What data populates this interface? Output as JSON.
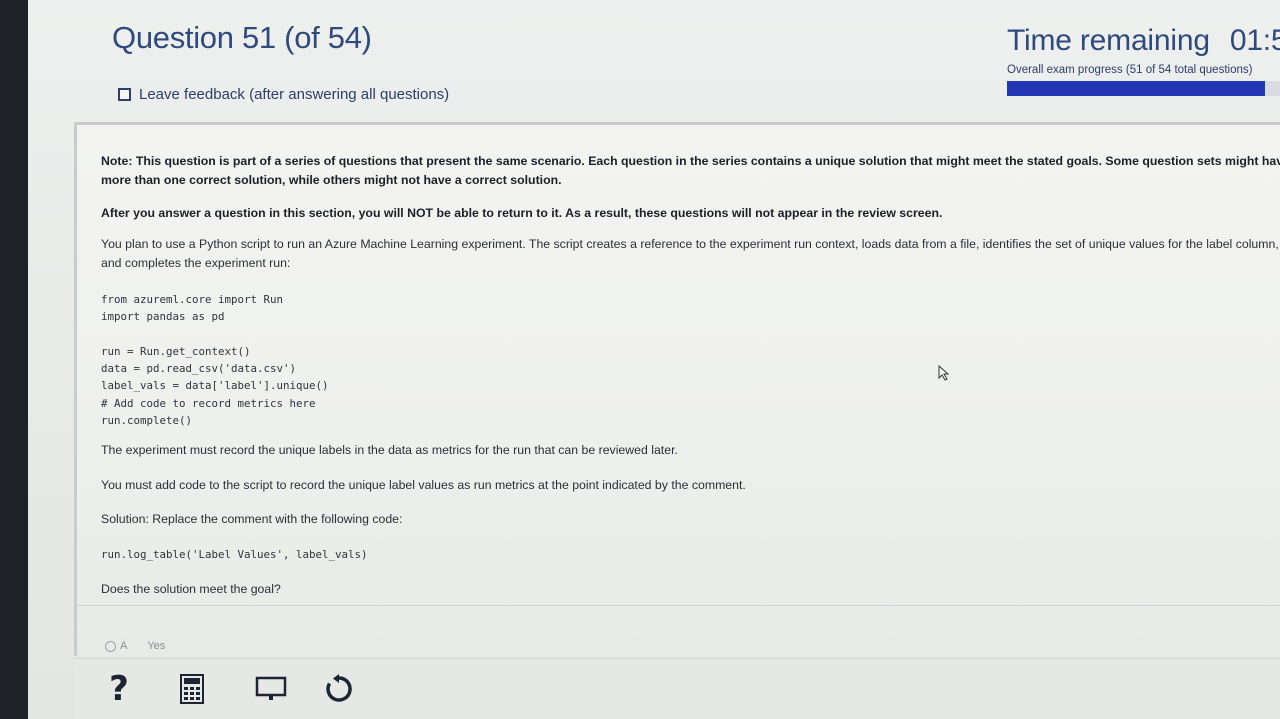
{
  "header": {
    "question_title": "Question 51 (of 54)",
    "feedback_label": "Leave feedback (after answering all questions)",
    "timer_label": "Time remaining",
    "timer_value": "01:5",
    "progress_label": "Overall exam progress (51 of 54 total questions)",
    "progress_fraction": 0.944
  },
  "question": {
    "note": "Note: This question is part of a series of questions that present the same scenario. Each question in the series contains a unique solution that might meet the stated goals. Some question sets might have more than one correct solution, while others might not have a correct solution.",
    "after_note": "After you answer a question in this section, you will NOT be able to return to it. As a result, these questions will not appear in the review screen.",
    "scenario": "You plan to use a Python script to run an Azure Machine Learning experiment. The script creates a reference to the experiment run context, loads data from a file, identifies the set of unique values for the label column, and completes the experiment run:",
    "code_block_1": "from azureml.core import Run\nimport pandas as pd",
    "code_block_2": "run = Run.get_context()\ndata = pd.read_csv('data.csv')\nlabel_vals = data['label'].unique()\n# Add code to record metrics here\nrun.complete()",
    "requirement_1": "The experiment must record the unique labels in the data as metrics for the run that can be reviewed later.",
    "requirement_2": "You must add code to the script to record the unique label values as run metrics at the point indicated by the comment.",
    "solution_label": "Solution: Replace the comment with the following code:",
    "solution_code": "run.log_table('Label Values', label_vals)",
    "prompt": "Does the solution meet the goal?"
  },
  "answers": [
    {
      "letter": "A",
      "text": "Yes"
    }
  ],
  "toolbar": {
    "icons": [
      "help-icon",
      "calculator-icon",
      "whiteboard-icon",
      "reset-icon"
    ]
  },
  "colors": {
    "title": "#2f4a7c",
    "progress_fill": "#2336b3",
    "progress_track": "#d8dbe0"
  }
}
